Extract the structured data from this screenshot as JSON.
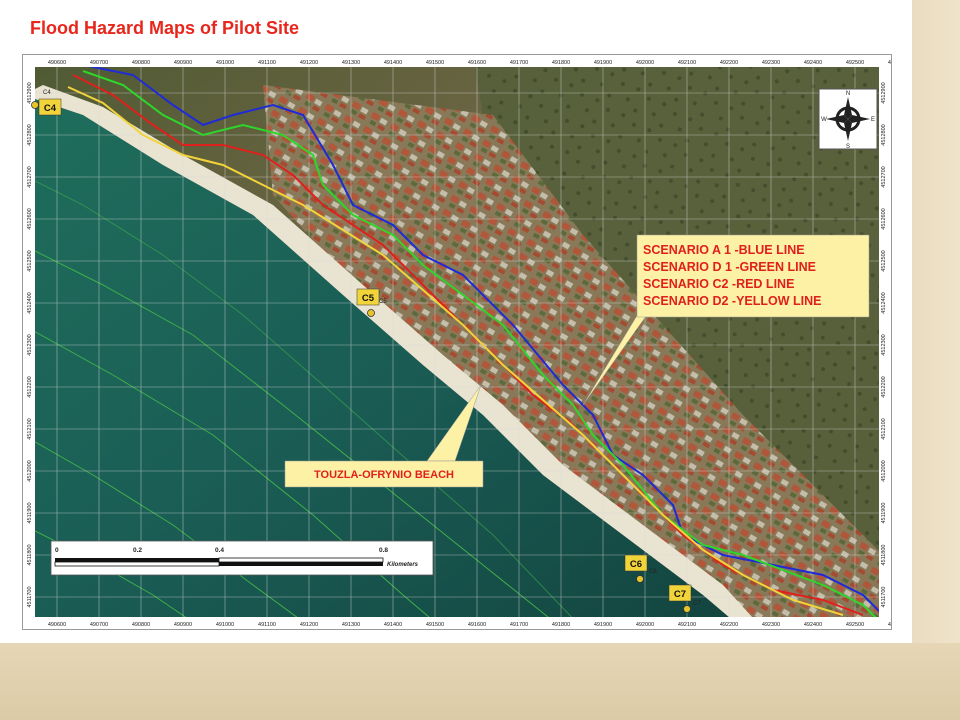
{
  "title": "Flood Hazard Maps of Pilot Site",
  "map": {
    "x_ticks": [
      "490600",
      "490700",
      "490800",
      "490900",
      "491000",
      "491100",
      "491200",
      "491300",
      "491400",
      "491500",
      "491600",
      "491700",
      "491800",
      "491900",
      "492000",
      "492100",
      "492200",
      "492300",
      "492400",
      "492500",
      "492600"
    ],
    "y_ticks": [
      "4512900",
      "4512800",
      "4512700",
      "4512600",
      "4512500",
      "4512400",
      "4512300",
      "4512200",
      "4512100",
      "4512000",
      "4511900",
      "4511800",
      "4511700"
    ],
    "legend": {
      "lines": [
        "SCENARIO  A 1 -BLUE LINE",
        "SCENARIO  D 1 -GREEN LINE",
        "SCENARIO  C2   -RED LINE",
        "SCENARIO  D2  -YELLOW LINE"
      ]
    },
    "beach_label": "TOUZLA-OFRYNIO BEACH",
    "points": [
      {
        "label": "C4",
        "small": "C4"
      },
      {
        "label": "C5",
        "small": "C5"
      },
      {
        "label": "C6",
        "small": "C6"
      },
      {
        "label": "C7",
        "small": "C7"
      }
    ],
    "scalebar": {
      "labels": [
        "0",
        "0.2",
        "0.4",
        "0.8"
      ],
      "unit": "Kilometers"
    },
    "compass": [
      "N",
      "S",
      "W",
      "E"
    ],
    "colors": {
      "blue_line": "#1f2bd6",
      "green_line": "#2fd62a",
      "red_line": "#e0201c",
      "yellow_line": "#f1d33a",
      "legend_bg": "#fdf1a6",
      "title": "#e8261c"
    }
  }
}
